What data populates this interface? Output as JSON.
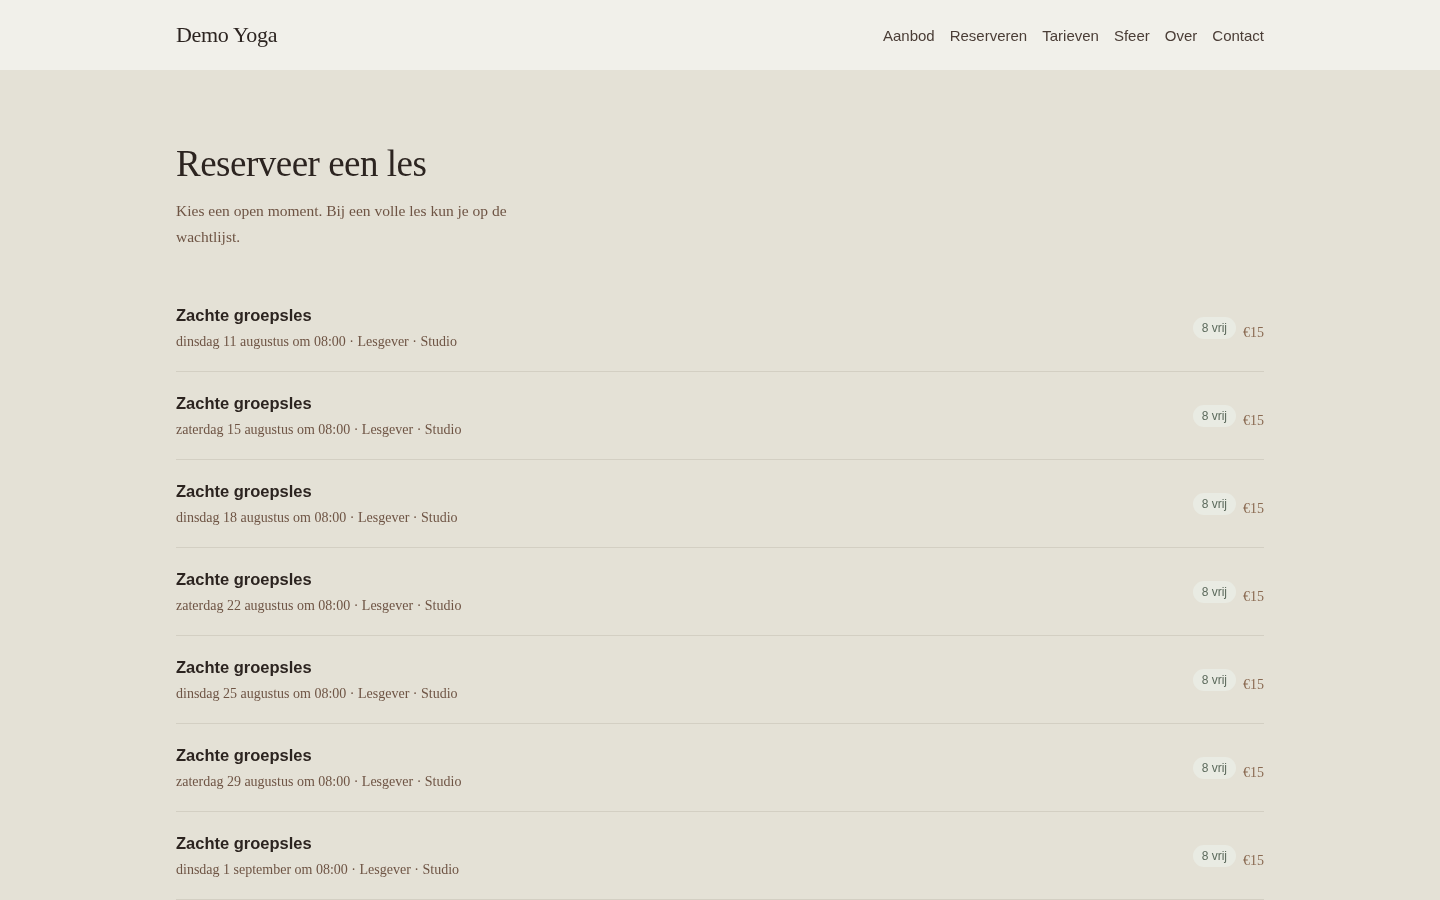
{
  "header": {
    "brand": "Demo Yoga",
    "nav": [
      "Aanbod",
      "Reserveren",
      "Tarieven",
      "Sfeer",
      "Over",
      "Contact"
    ]
  },
  "page": {
    "title": "Reserveer een les",
    "intro": "Kies een open moment. Bij een volle les kun je op de wachtlijst."
  },
  "sessions": [
    {
      "title": "Zachte groepsles",
      "detail": "dinsdag 11 augustus om 08:00 · Lesgever · Studio",
      "availability": "8 vrij",
      "price": "€15"
    },
    {
      "title": "Zachte groepsles",
      "detail": "zaterdag 15 augustus om 08:00 · Lesgever · Studio",
      "availability": "8 vrij",
      "price": "€15"
    },
    {
      "title": "Zachte groepsles",
      "detail": "dinsdag 18 augustus om 08:00 · Lesgever · Studio",
      "availability": "8 vrij",
      "price": "€15"
    },
    {
      "title": "Zachte groepsles",
      "detail": "zaterdag 22 augustus om 08:00 · Lesgever · Studio",
      "availability": "8 vrij",
      "price": "€15"
    },
    {
      "title": "Zachte groepsles",
      "detail": "dinsdag 25 augustus om 08:00 · Lesgever · Studio",
      "availability": "8 vrij",
      "price": "€15"
    },
    {
      "title": "Zachte groepsles",
      "detail": "zaterdag 29 augustus om 08:00 · Lesgever · Studio",
      "availability": "8 vrij",
      "price": "€15"
    },
    {
      "title": "Zachte groepsles",
      "detail": "dinsdag 1 september om 08:00 · Lesgever · Studio",
      "availability": "8 vrij",
      "price": "€15"
    }
  ]
}
